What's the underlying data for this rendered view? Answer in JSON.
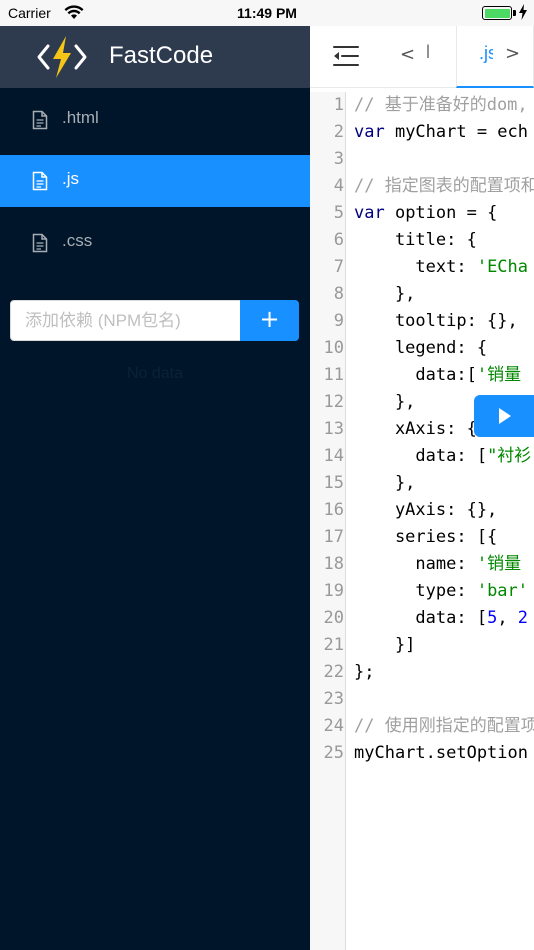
{
  "status_bar": {
    "carrier": "Carrier",
    "time": "11:49 PM",
    "battery_level": 1.0
  },
  "sidebar": {
    "app_name": "FastCode",
    "files": [
      {
        "label": ".html",
        "active": false
      },
      {
        "label": ".js",
        "active": true
      },
      {
        "label": ".css",
        "active": false
      }
    ],
    "dependency_input_placeholder": "添加依赖 (NPM包名)",
    "add_button_label": "+",
    "empty_text": "No data"
  },
  "editor": {
    "tabs": {
      "prev_arrow": "<",
      "html_tab": "l",
      "js_tab": ".js",
      "next_arrow": ">"
    },
    "lines": [
      {
        "n": "1",
        "tokens": [
          {
            "t": "// 基于准备好的dom,",
            "c": "comment"
          }
        ]
      },
      {
        "n": "2",
        "tokens": [
          {
            "t": "var",
            "c": "keyword"
          },
          {
            "t": " myChart = ech",
            "c": ""
          }
        ]
      },
      {
        "n": "3",
        "tokens": []
      },
      {
        "n": "4",
        "tokens": [
          {
            "t": "// 指定图表的配置项和",
            "c": "comment"
          }
        ]
      },
      {
        "n": "5",
        "tokens": [
          {
            "t": "var",
            "c": "keyword"
          },
          {
            "t": " option = {",
            "c": ""
          }
        ]
      },
      {
        "n": "6",
        "tokens": [
          {
            "t": "    title: {",
            "c": ""
          }
        ]
      },
      {
        "n": "7",
        "tokens": [
          {
            "t": "      text: ",
            "c": ""
          },
          {
            "t": "'ECha",
            "c": "string"
          }
        ]
      },
      {
        "n": "8",
        "tokens": [
          {
            "t": "    },",
            "c": ""
          }
        ]
      },
      {
        "n": "9",
        "tokens": [
          {
            "t": "    tooltip: {},",
            "c": ""
          }
        ]
      },
      {
        "n": "10",
        "tokens": [
          {
            "t": "    legend: {",
            "c": ""
          }
        ]
      },
      {
        "n": "11",
        "tokens": [
          {
            "t": "      data:[",
            "c": ""
          },
          {
            "t": "'销量",
            "c": "string"
          }
        ]
      },
      {
        "n": "12",
        "tokens": [
          {
            "t": "    },",
            "c": ""
          }
        ]
      },
      {
        "n": "13",
        "tokens": [
          {
            "t": "    xAxis: {",
            "c": ""
          }
        ]
      },
      {
        "n": "14",
        "tokens": [
          {
            "t": "      data: [",
            "c": ""
          },
          {
            "t": "\"衬衫",
            "c": "string"
          }
        ]
      },
      {
        "n": "15",
        "tokens": [
          {
            "t": "    },",
            "c": ""
          }
        ]
      },
      {
        "n": "16",
        "tokens": [
          {
            "t": "    yAxis: {},",
            "c": ""
          }
        ]
      },
      {
        "n": "17",
        "tokens": [
          {
            "t": "    series: [{",
            "c": ""
          }
        ]
      },
      {
        "n": "18",
        "tokens": [
          {
            "t": "      name: ",
            "c": ""
          },
          {
            "t": "'销量",
            "c": "string"
          }
        ]
      },
      {
        "n": "19",
        "tokens": [
          {
            "t": "      type: ",
            "c": ""
          },
          {
            "t": "'bar'",
            "c": "string"
          }
        ]
      },
      {
        "n": "20",
        "tokens": [
          {
            "t": "      data: [",
            "c": ""
          },
          {
            "t": "5",
            "c": "number"
          },
          {
            "t": ", ",
            "c": ""
          },
          {
            "t": "2",
            "c": "number"
          }
        ]
      },
      {
        "n": "21",
        "tokens": [
          {
            "t": "    }]",
            "c": ""
          }
        ]
      },
      {
        "n": "22",
        "tokens": [
          {
            "t": "};",
            "c": ""
          }
        ]
      },
      {
        "n": "23",
        "tokens": []
      },
      {
        "n": "24",
        "tokens": [
          {
            "t": "// 使用刚指定的配置项",
            "c": "comment"
          }
        ]
      },
      {
        "n": "25",
        "tokens": [
          {
            "t": "myChart.setOption",
            "c": ""
          }
        ]
      }
    ]
  },
  "colors": {
    "sidebar_bg": "#001529",
    "brand_bg": "#2e3b4e",
    "accent": "#1890ff",
    "logo_yellow": "#f5c518"
  }
}
